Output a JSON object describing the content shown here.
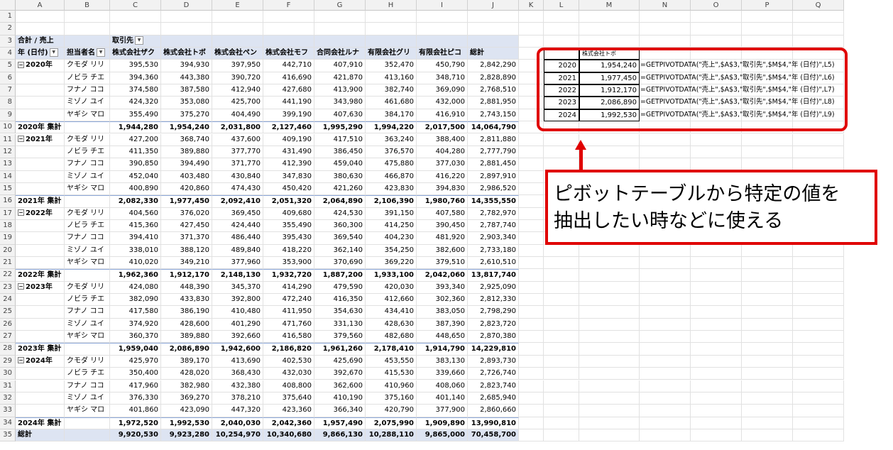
{
  "columns": [
    "A",
    "B",
    "C",
    "D",
    "E",
    "F",
    "G",
    "H",
    "I",
    "J",
    "K",
    "L",
    "M",
    "N",
    "O",
    "P",
    "Q"
  ],
  "pivot": {
    "value_label": "合計 / 売上",
    "col_field": "取引先",
    "year_field": "年 (日付)",
    "person_field": "担当者名",
    "companies": [
      "株式会社ザク",
      "株式会社トボ",
      "株式会社ペン",
      "株式会社モフ",
      "合同会社ルナ",
      "有限会社グリ",
      "有限会社ピコ",
      "総計"
    ],
    "blocks": [
      {
        "year": "2020年",
        "subtotal_label": "2020年 集計",
        "rows": [
          {
            "person": "クモダ リリ",
            "values": [
              "395,530",
              "394,930",
              "397,950",
              "442,710",
              "407,910",
              "352,470",
              "450,790",
              "2,842,290"
            ]
          },
          {
            "person": "ノビラ チエ",
            "values": [
              "394,360",
              "443,380",
              "390,720",
              "416,690",
              "421,870",
              "413,160",
              "348,710",
              "2,828,890"
            ]
          },
          {
            "person": "フナノ ココ",
            "values": [
              "374,580",
              "387,580",
              "412,940",
              "427,680",
              "413,900",
              "382,740",
              "369,090",
              "2,768,510"
            ]
          },
          {
            "person": "ミゾノ ユイ",
            "values": [
              "424,320",
              "353,080",
              "425,700",
              "441,190",
              "343,980",
              "461,680",
              "432,000",
              "2,881,950"
            ]
          },
          {
            "person": "ヤギシ マロ",
            "values": [
              "355,490",
              "375,270",
              "404,490",
              "399,190",
              "407,630",
              "384,170",
              "416,910",
              "2,743,150"
            ]
          }
        ],
        "subtotal": [
          "1,944,280",
          "1,954,240",
          "2,031,800",
          "2,127,460",
          "1,995,290",
          "1,994,220",
          "2,017,500",
          "14,064,790"
        ]
      },
      {
        "year": "2021年",
        "subtotal_label": "2021年 集計",
        "rows": [
          {
            "person": "クモダ リリ",
            "values": [
              "427,200",
              "368,740",
              "437,600",
              "409,190",
              "417,510",
              "363,240",
              "388,400",
              "2,811,880"
            ]
          },
          {
            "person": "ノビラ チエ",
            "values": [
              "411,350",
              "389,880",
              "377,770",
              "431,490",
              "386,450",
              "376,570",
              "404,280",
              "2,777,790"
            ]
          },
          {
            "person": "フナノ ココ",
            "values": [
              "390,850",
              "394,490",
              "371,770",
              "412,390",
              "459,040",
              "475,880",
              "377,030",
              "2,881,450"
            ]
          },
          {
            "person": "ミゾノ ユイ",
            "values": [
              "452,040",
              "403,480",
              "430,840",
              "347,830",
              "380,630",
              "466,870",
              "416,220",
              "2,897,910"
            ]
          },
          {
            "person": "ヤギシ マロ",
            "values": [
              "400,890",
              "420,860",
              "474,430",
              "450,420",
              "421,260",
              "423,830",
              "394,830",
              "2,986,520"
            ]
          }
        ],
        "subtotal": [
          "2,082,330",
          "1,977,450",
          "2,092,410",
          "2,051,320",
          "2,064,890",
          "2,106,390",
          "1,980,760",
          "14,355,550"
        ]
      },
      {
        "year": "2022年",
        "subtotal_label": "2022年 集計",
        "rows": [
          {
            "person": "クモダ リリ",
            "values": [
              "404,560",
              "376,020",
              "369,450",
              "409,680",
              "424,530",
              "391,150",
              "407,580",
              "2,782,970"
            ]
          },
          {
            "person": "ノビラ チエ",
            "values": [
              "415,360",
              "427,450",
              "424,440",
              "355,490",
              "360,300",
              "414,250",
              "390,450",
              "2,787,740"
            ]
          },
          {
            "person": "フナノ ココ",
            "values": [
              "394,410",
              "371,370",
              "486,440",
              "395,430",
              "369,540",
              "404,230",
              "481,920",
              "2,903,340"
            ]
          },
          {
            "person": "ミゾノ ユイ",
            "values": [
              "338,010",
              "388,120",
              "489,840",
              "418,220",
              "362,140",
              "354,250",
              "382,600",
              "2,733,180"
            ]
          },
          {
            "person": "ヤギシ マロ",
            "values": [
              "410,020",
              "349,210",
              "377,960",
              "353,900",
              "370,690",
              "369,220",
              "379,510",
              "2,610,510"
            ]
          }
        ],
        "subtotal": [
          "1,962,360",
          "1,912,170",
          "2,148,130",
          "1,932,720",
          "1,887,200",
          "1,933,100",
          "2,042,060",
          "13,817,740"
        ]
      },
      {
        "year": "2023年",
        "subtotal_label": "2023年 集計",
        "rows": [
          {
            "person": "クモダ リリ",
            "values": [
              "424,080",
              "448,390",
              "345,370",
              "414,290",
              "479,590",
              "420,030",
              "393,340",
              "2,925,090"
            ]
          },
          {
            "person": "ノビラ チエ",
            "values": [
              "382,090",
              "433,830",
              "392,800",
              "472,240",
              "416,350",
              "412,660",
              "302,360",
              "2,812,330"
            ]
          },
          {
            "person": "フナノ ココ",
            "values": [
              "417,580",
              "386,190",
              "410,480",
              "411,950",
              "354,630",
              "434,410",
              "383,050",
              "2,798,290"
            ]
          },
          {
            "person": "ミゾノ ユイ",
            "values": [
              "374,920",
              "428,600",
              "401,290",
              "471,760",
              "331,130",
              "428,630",
              "387,390",
              "2,823,720"
            ]
          },
          {
            "person": "ヤギシ マロ",
            "values": [
              "360,370",
              "389,880",
              "392,660",
              "416,580",
              "379,560",
              "482,680",
              "448,650",
              "2,870,380"
            ]
          }
        ],
        "subtotal": [
          "1,959,040",
          "2,086,890",
          "1,942,600",
          "2,186,820",
          "1,961,260",
          "2,178,410",
          "1,914,790",
          "14,229,810"
        ]
      },
      {
        "year": "2024年",
        "subtotal_label": "2024年 集計",
        "rows": [
          {
            "person": "クモダ リリ",
            "values": [
              "425,970",
              "389,170",
              "413,690",
              "402,530",
              "425,690",
              "453,550",
              "383,130",
              "2,893,730"
            ]
          },
          {
            "person": "ノビラ チエ",
            "values": [
              "350,400",
              "428,020",
              "368,430",
              "432,030",
              "392,670",
              "415,530",
              "339,660",
              "2,726,740"
            ]
          },
          {
            "person": "フナノ ココ",
            "values": [
              "417,960",
              "382,980",
              "432,380",
              "408,800",
              "362,600",
              "410,960",
              "408,060",
              "2,823,740"
            ]
          },
          {
            "person": "ミゾノ ユイ",
            "values": [
              "376,330",
              "369,270",
              "378,210",
              "375,640",
              "410,190",
              "375,160",
              "401,140",
              "2,685,940"
            ]
          },
          {
            "person": "ヤギシ マロ",
            "values": [
              "401,860",
              "423,090",
              "447,320",
              "423,360",
              "366,340",
              "420,790",
              "377,900",
              "2,860,660"
            ]
          }
        ],
        "subtotal": [
          "1,972,520",
          "1,992,530",
          "2,040,030",
          "2,042,360",
          "1,957,490",
          "2,075,990",
          "1,909,890",
          "13,990,810"
        ]
      }
    ],
    "grand_label": "総計",
    "grand": [
      "9,920,530",
      "9,923,280",
      "10,254,970",
      "10,340,680",
      "9,866,130",
      "10,288,110",
      "9,865,000",
      "70,458,700"
    ]
  },
  "lookup": {
    "header": "株式会社トボ",
    "rows": [
      {
        "year": "2020",
        "value": "1,954,240",
        "formula": "=GETPIVOTDATA(\"売上\",$A$3,\"取引先\",$M$4,\"年 (日付)\",L5)"
      },
      {
        "year": "2021",
        "value": "1,977,450",
        "formula": "=GETPIVOTDATA(\"売上\",$A$3,\"取引先\",$M$4,\"年 (日付)\",L6)"
      },
      {
        "year": "2022",
        "value": "1,912,170",
        "formula": "=GETPIVOTDATA(\"売上\",$A$3,\"取引先\",$M$4,\"年 (日付)\",L7)"
      },
      {
        "year": "2023",
        "value": "2,086,890",
        "formula": "=GETPIVOTDATA(\"売上\",$A$3,\"取引先\",$M$4,\"年 (日付)\",L8)"
      },
      {
        "year": "2024",
        "value": "1,992,530",
        "formula": "=GETPIVOTDATA(\"売上\",$A$3,\"取引先\",$M$4,\"年 (日付)\",L9)"
      }
    ]
  },
  "callout": {
    "line1": "ピボットテーブルから特定の値を",
    "line2": "抽出したい時などに使える"
  },
  "colors": {
    "accent": "#e00000",
    "pivot_header": "#dde4f2",
    "pivot_rule": "#8ea9db"
  }
}
